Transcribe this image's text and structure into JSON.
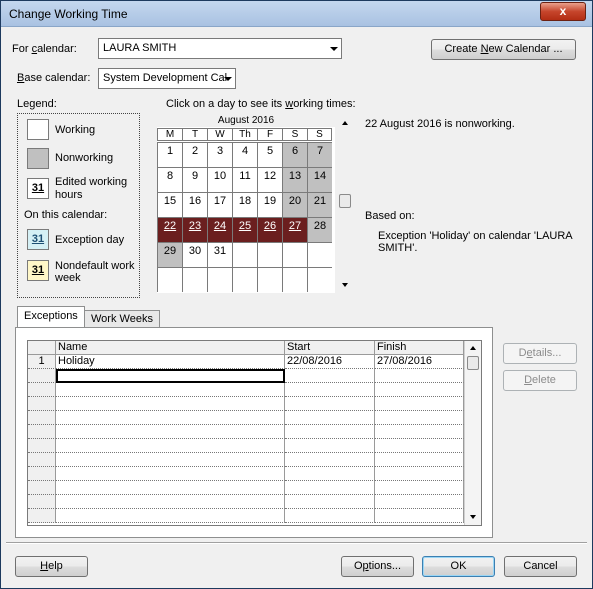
{
  "window": {
    "title": "Change Working Time",
    "close_glyph": "x"
  },
  "calendar_select": {
    "label_pre": "For ",
    "label_ul": "c",
    "label_post": "alendar:",
    "value": "LAURA SMITH"
  },
  "base_calendar": {
    "label_ul": "B",
    "label_post": "ase calendar:",
    "value": "System Development Cal"
  },
  "create_button": {
    "pre": "Create ",
    "ul": "N",
    "post": "ew Calendar ..."
  },
  "legend": {
    "title": "Legend:",
    "working": "Working",
    "nonworking": "Nonworking",
    "edited_line1": "Edited working",
    "edited_line2": "hours",
    "on_this_calendar": "On this calendar:",
    "exception_day": "Exception day",
    "nondefault_line1": "Nondefault work",
    "nondefault_line2": "week",
    "swatch_number": "31"
  },
  "calendar": {
    "instruction_pre": "Click on a day to see its ",
    "instruction_ul": "w",
    "instruction_post": "orking times:",
    "month": "August 2016",
    "day_headers": [
      "M",
      "T",
      "W",
      "Th",
      "F",
      "S",
      "S"
    ],
    "weeks": [
      [
        {
          "d": "1",
          "s": "w"
        },
        {
          "d": "2",
          "s": "w"
        },
        {
          "d": "3",
          "s": "w"
        },
        {
          "d": "4",
          "s": "w"
        },
        {
          "d": "5",
          "s": "w"
        },
        {
          "d": "6",
          "s": "n"
        },
        {
          "d": "7",
          "s": "n"
        }
      ],
      [
        {
          "d": "8",
          "s": "w"
        },
        {
          "d": "9",
          "s": "w"
        },
        {
          "d": "10",
          "s": "w"
        },
        {
          "d": "11",
          "s": "w"
        },
        {
          "d": "12",
          "s": "w"
        },
        {
          "d": "13",
          "s": "n"
        },
        {
          "d": "14",
          "s": "n"
        }
      ],
      [
        {
          "d": "15",
          "s": "w"
        },
        {
          "d": "16",
          "s": "w"
        },
        {
          "d": "17",
          "s": "w"
        },
        {
          "d": "18",
          "s": "w"
        },
        {
          "d": "19",
          "s": "w"
        },
        {
          "d": "20",
          "s": "n"
        },
        {
          "d": "21",
          "s": "n"
        }
      ],
      [
        {
          "d": "22",
          "s": "e"
        },
        {
          "d": "23",
          "s": "e"
        },
        {
          "d": "24",
          "s": "e"
        },
        {
          "d": "25",
          "s": "e"
        },
        {
          "d": "26",
          "s": "e"
        },
        {
          "d": "27",
          "s": "e"
        },
        {
          "d": "28",
          "s": "n"
        }
      ],
      [
        {
          "d": "29",
          "s": "n"
        },
        {
          "d": "30",
          "s": "w"
        },
        {
          "d": "31",
          "s": "w"
        },
        {
          "d": "",
          "s": "w"
        },
        {
          "d": "",
          "s": "w"
        },
        {
          "d": "",
          "s": "w"
        },
        {
          "d": "",
          "s": "w"
        }
      ],
      [
        {
          "d": "",
          "s": "w"
        },
        {
          "d": "",
          "s": "w"
        },
        {
          "d": "",
          "s": "w"
        },
        {
          "d": "",
          "s": "w"
        },
        {
          "d": "",
          "s": "w"
        },
        {
          "d": "",
          "s": "w"
        },
        {
          "d": "",
          "s": "w"
        }
      ]
    ]
  },
  "day_info": {
    "status": "22 August 2016 is nonworking.",
    "based_on_label": "Based on:",
    "based_on_line1": "Exception 'Holiday' on calendar 'LAURA",
    "based_on_line2": "SMITH'."
  },
  "tabs": [
    {
      "label": "Exceptions",
      "active": true
    },
    {
      "label": "Work Weeks",
      "active": false
    }
  ],
  "exceptions_table": {
    "columns": [
      "Name",
      "Start",
      "Finish"
    ],
    "rows": [
      {
        "num": "1",
        "name": "Holiday",
        "start": "22/08/2016",
        "finish": "27/08/2016"
      }
    ],
    "empty_rows": 11
  },
  "side_buttons": {
    "details_pre": "D",
    "details_ul": "e",
    "details_post": "tails...",
    "delete_ul": "D",
    "delete_post": "elete"
  },
  "footer": {
    "help_ul": "H",
    "help_post": "elp",
    "options_pre": "O",
    "options_ul": "p",
    "options_post": "tions...",
    "ok": "OK",
    "cancel": "Cancel"
  }
}
